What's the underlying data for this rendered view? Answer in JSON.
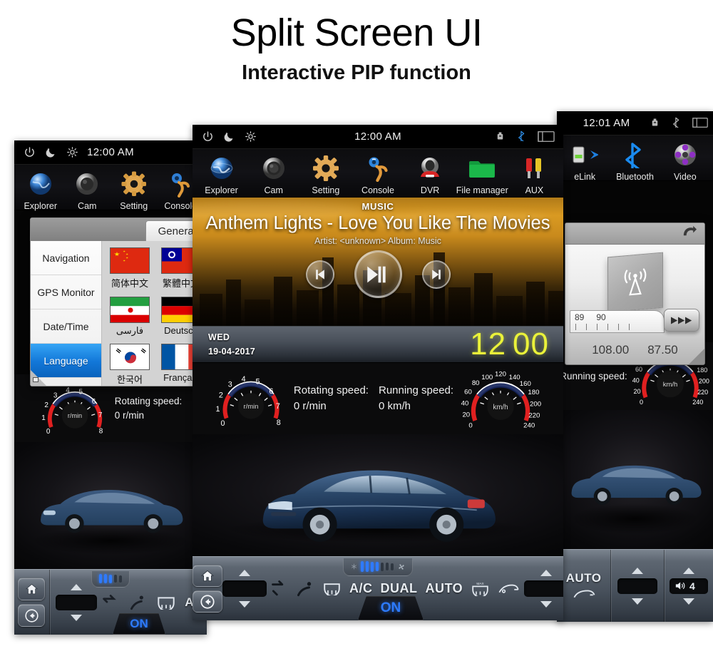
{
  "headings": {
    "title": "Split Screen UI",
    "subtitle": "Interactive PIP function"
  },
  "status_bar": {
    "icons_left": [
      "power-icon",
      "night-mode-icon",
      "brightness-icon"
    ],
    "icons_right": [
      "usb-icon",
      "bluetooth-icon",
      "screen-off-icon"
    ],
    "clock_center": "12:00 AM",
    "clock_right_panel": "12:01 AM"
  },
  "app_bar": {
    "apps": [
      {
        "label": "Explorer",
        "icon": "globe-icon"
      },
      {
        "label": "Cam",
        "icon": "camera-icon"
      },
      {
        "label": "Setting",
        "icon": "gear-icon"
      },
      {
        "label": "Console",
        "icon": "steering-wheel-icon"
      },
      {
        "label": "DVR",
        "icon": "dashcam-icon"
      },
      {
        "label": "File manager",
        "icon": "folder-icon"
      },
      {
        "label": "AUX",
        "icon": "rca-plugs-icon"
      }
    ],
    "right_panel_apps": [
      {
        "label": "eLink",
        "icon": "phone-link-icon"
      },
      {
        "label": "Bluetooth",
        "icon": "bluetooth-icon"
      },
      {
        "label": "Video",
        "icon": "video-icon"
      }
    ]
  },
  "media": {
    "kicker": "MUSIC",
    "track_title": "Anthem Lights - Love You Like The Movies",
    "meta": "Artist: <unknown>  Album: Music",
    "controls": [
      "previous-track-button",
      "play-pause-button",
      "next-track-button"
    ]
  },
  "date_strip": {
    "day": "WED",
    "date": "19-04-2017",
    "hours": "12",
    "minutes": "00",
    "clock_color": "#eaf23a"
  },
  "gauges": {
    "tachometer": {
      "label": "Rotating speed:",
      "value": "0 r/min",
      "unit": "r/min",
      "ticks": [
        "0",
        "1",
        "2",
        "3",
        "4",
        "5",
        "6",
        "7",
        "8"
      ],
      "redline_low": "0",
      "redline_high": "8"
    },
    "speedometer": {
      "label": "Running speed:",
      "value": "0 km/h",
      "unit": "km/h",
      "ticks": [
        "0",
        "20",
        "40",
        "60",
        "80",
        "100",
        "120",
        "140",
        "160",
        "180",
        "200",
        "220",
        "240"
      ]
    }
  },
  "hvac": {
    "home_icon": "home-icon",
    "back_icon": "back-arrow-icon",
    "left_temp_value": "",
    "right_temp_value": "",
    "buttons": [
      "A/C",
      "DUAL",
      "AUTO"
    ],
    "on_label": "ON",
    "icons": [
      "recirculate-icon",
      "front-defrost-icon",
      "airflow-face-icon",
      "rear-defrost-max-icon",
      "rear-window-defog-icon"
    ],
    "volume_icon": "speaker-icon",
    "volume_value": "4",
    "stepper_icons": [
      "arrow-up-icon",
      "arrow-down-icon"
    ],
    "vent_lit_bars": 5,
    "vent_total_bars": 8
  },
  "settings_dialog": {
    "tab_label": "General",
    "nav_items": [
      {
        "label": "Navigation",
        "active": false
      },
      {
        "label": "GPS Monitor",
        "active": false
      },
      {
        "label": "Date/Time",
        "active": false
      },
      {
        "label": "Language",
        "active": true
      }
    ],
    "languages": [
      {
        "name": "简体中文",
        "flag": "china-flag"
      },
      {
        "name": "繁體中文",
        "flag": "taiwan-flag"
      },
      {
        "name": "فارسی",
        "flag": "iran-flag"
      },
      {
        "name": "Deutsch",
        "flag": "germany-flag"
      },
      {
        "name": "한국어",
        "flag": "korea-flag"
      },
      {
        "name": "Français",
        "flag": "france-flag"
      }
    ],
    "accent_color": "#1277d8"
  },
  "radio_dialog": {
    "back_icon": "back-arrow-icon",
    "antenna_icon": "radio-antenna-icon",
    "seek_icon": "seek-forward-icon",
    "scale_labels": [
      "89",
      "90"
    ],
    "freq_high": "108.00",
    "freq_low": "87.50"
  },
  "car_image": {
    "description": "dark-blue-sedan",
    "body_color": "#1e3350"
  }
}
